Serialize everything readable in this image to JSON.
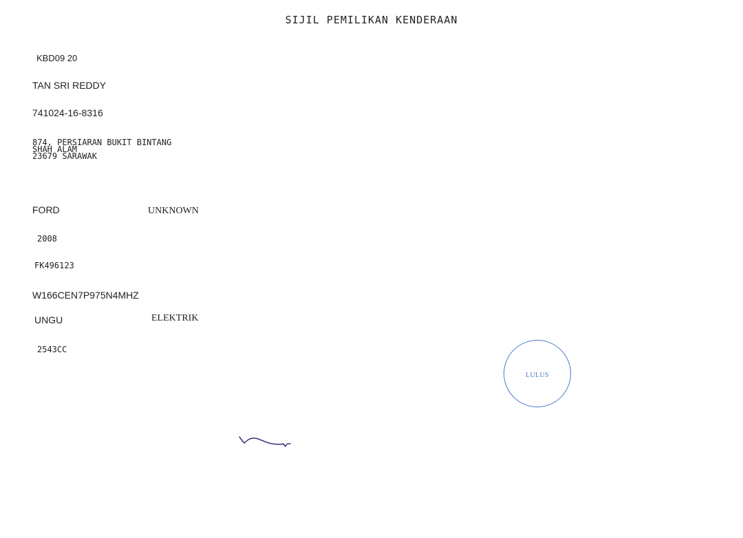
{
  "document": {
    "title": "SIJIL PEMILIKAN KENDERAAN",
    "registration_no": "KBD09 20",
    "owner_name": "TAN SRI REDDY",
    "ic_no": "741024-16-8316",
    "address": {
      "line1": "874, PERSIARAN BUKIT BINTANG",
      "line2": "SHAH ALAM",
      "line3": "23679 SARAWAK"
    },
    "make": "FORD",
    "model": "UNKNOWN",
    "year": "2008",
    "engine_no": "FK496123",
    "chassis_no": "W166CEN7P975N4MHZ",
    "colour": "UNGU",
    "fuel": "ELEKTRIK",
    "engine_capacity": "2543CC"
  },
  "stamp": {
    "text": "LULUS",
    "color": "#4a7bd0"
  },
  "signature": {
    "color": "#3a2a7a"
  }
}
